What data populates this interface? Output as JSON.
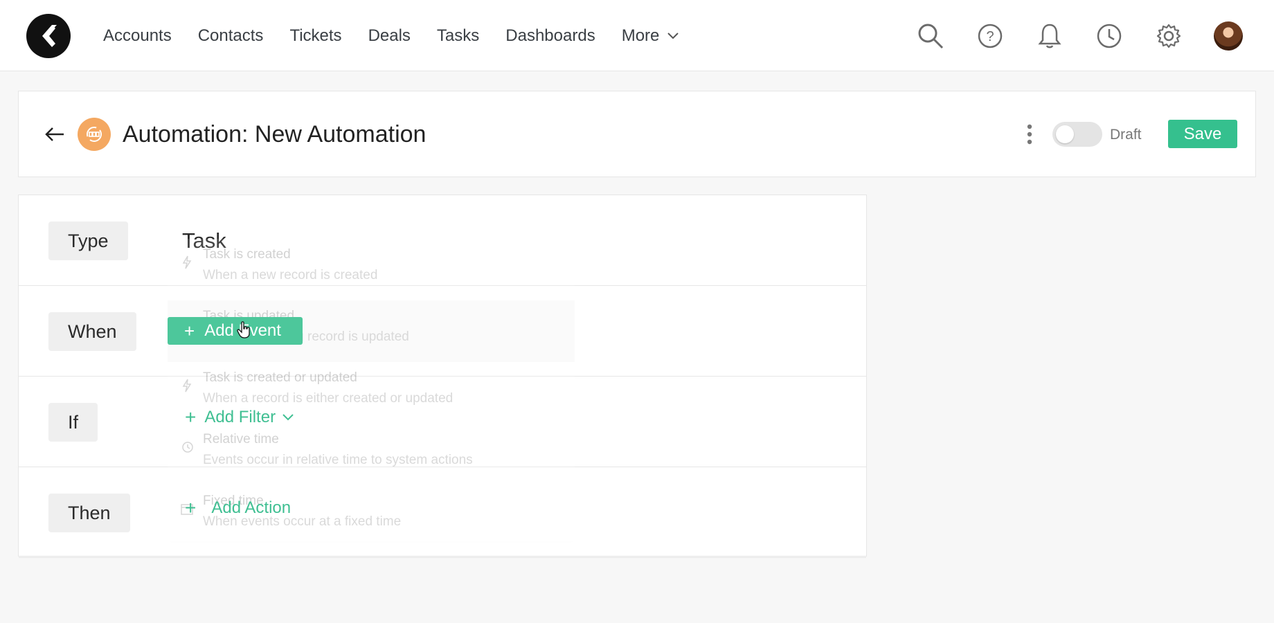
{
  "nav": {
    "items": [
      "Accounts",
      "Contacts",
      "Tickets",
      "Deals",
      "Tasks",
      "Dashboards"
    ],
    "more_label": "More"
  },
  "header": {
    "title": "Automation: New Automation",
    "status_label": "Draft",
    "save_label": "Save"
  },
  "builder": {
    "type_label": "Type",
    "type_value": "Task",
    "when_label": "When",
    "add_event_label": "Add Event",
    "if_label": "If",
    "add_filter_label": "Add Filter",
    "then_label": "Then",
    "add_action_label": "Add Action"
  },
  "event_menu": [
    {
      "title": "Task is created",
      "desc": "When a new record is created",
      "icon": "bolt-icon"
    },
    {
      "title": "Task is updated",
      "desc": "When an existing record is updated",
      "icon": "bolt-icon"
    },
    {
      "title": "Task is created or updated",
      "desc": "When a record is either created or updated",
      "icon": "bolt-icon"
    },
    {
      "title": "Relative time",
      "desc": "Events occur in relative time to system actions",
      "icon": "history-icon"
    },
    {
      "title": "Fixed time",
      "desc": "When events occur at a fixed time",
      "icon": "calendar-icon"
    }
  ],
  "colors": {
    "accent": "#35c08e",
    "automation_icon": "#f4a861"
  }
}
